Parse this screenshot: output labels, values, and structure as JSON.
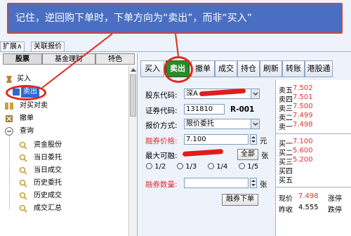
{
  "banner": {
    "text": "记住，逆回购下单时，下单方向为“卖出”，而非“买入”"
  },
  "menubar": {
    "items": [
      "扩展∧",
      "关联报价"
    ]
  },
  "left_tabs": [
    {
      "label": "股票",
      "active": true
    },
    {
      "label": "基金理财",
      "active": false
    },
    {
      "label": "特色",
      "active": false
    }
  ],
  "tree": [
    {
      "label": "买入",
      "icon": "buy-icon",
      "level": 0
    },
    {
      "label": "卖出",
      "icon": "sell-icon",
      "level": 0,
      "selected": true
    },
    {
      "label": "对买对卖",
      "icon": "trade-pair-icon",
      "level": 0
    },
    {
      "label": "撤单",
      "icon": "cancel-order-icon",
      "level": 0
    },
    {
      "label": "查询",
      "icon": "collapse-minus-icon",
      "level": 0
    },
    {
      "label": "资金股份",
      "icon": "query-icon",
      "level": 1
    },
    {
      "label": "当日委托",
      "icon": "query-icon",
      "level": 1
    },
    {
      "label": "当日成交",
      "icon": "query-icon",
      "level": 1
    },
    {
      "label": "历史委托",
      "icon": "query-icon",
      "level": 1
    },
    {
      "label": "历史成交",
      "icon": "query-icon",
      "level": 1
    },
    {
      "label": "成交汇总",
      "icon": "query-icon",
      "level": 1
    }
  ],
  "toolbar": [
    "买入",
    "卖出",
    "撤单",
    "成交",
    "持仓",
    "刷新",
    "转账",
    "港股通"
  ],
  "toolbar_active": "卖出",
  "form": {
    "holder_label": "股东代码:",
    "holder_value": "深A",
    "security_label": "证券代码:",
    "security_code": "131810",
    "security_name": "R-001",
    "price_mode_label": "报价方式:",
    "price_mode_value": "限价委托",
    "price_label": "融券价格:",
    "price_value": "7.100",
    "price_unit": "元",
    "max_label": "最大可融:",
    "all_button": "全部",
    "max_unit": "张",
    "ratios": [
      "1/2",
      "1/3",
      "1/4",
      "1/5"
    ],
    "qty_label": "融券数量:",
    "qty_value": "",
    "qty_unit": "张",
    "submit_button": "融券下单"
  },
  "quote": {
    "sell": [
      {
        "label": "卖五",
        "value": "7.502"
      },
      {
        "label": "卖四",
        "value": "7.501"
      },
      {
        "label": "卖三",
        "value": "7.500"
      },
      {
        "label": "卖二",
        "value": "7.499"
      },
      {
        "label": "卖一",
        "value": "7.498"
      }
    ],
    "buy": [
      {
        "label": "买一",
        "value": "7.100"
      },
      {
        "label": "买二",
        "value": "5.600"
      },
      {
        "label": "买三",
        "value": "5.200"
      },
      {
        "label": "买四",
        "value": ""
      },
      {
        "label": "买五",
        "value": ""
      }
    ],
    "last_label": "现价",
    "last_value": "7.498",
    "limit_up_label": "涨停",
    "prev_label": "昨收",
    "prev_value": "4.555",
    "limit_down_label": "跌停"
  },
  "colors": {
    "accent_red": "#e0271f",
    "banner_blue": "#4a6fc2",
    "active_green": "#2c8a2a",
    "quote_red": "#dd3333"
  }
}
